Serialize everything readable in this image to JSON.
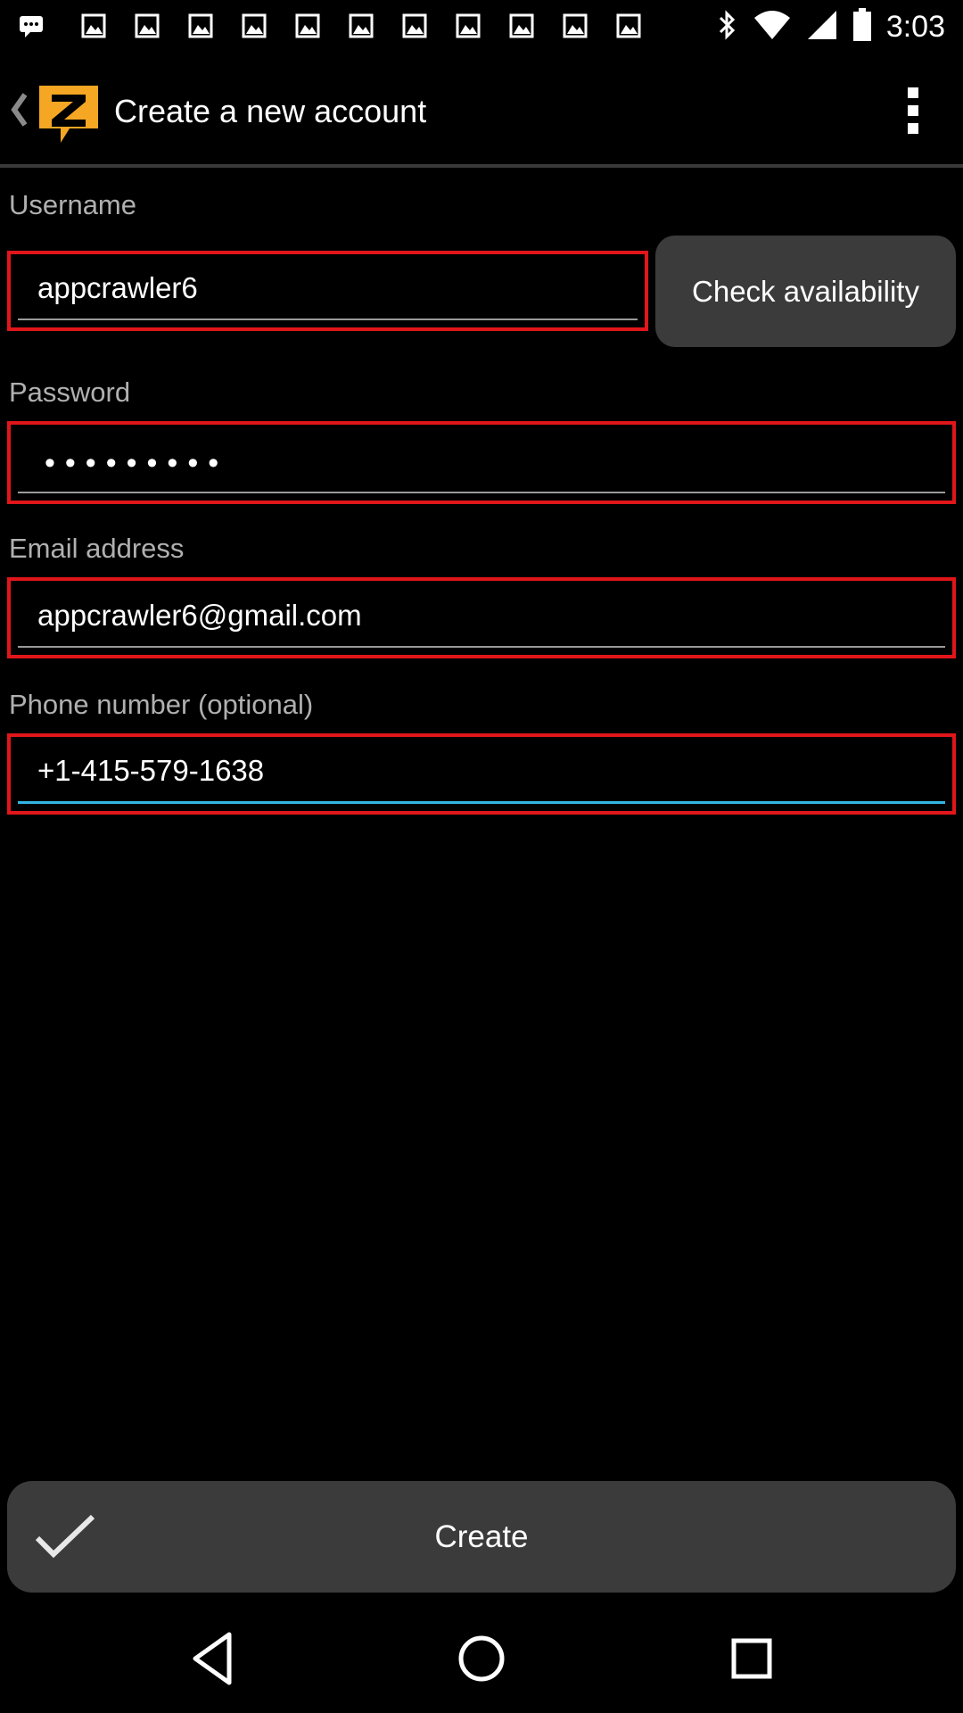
{
  "status_bar": {
    "time": "3:03",
    "notification_icons": [
      "message-icon",
      "photo-icon",
      "photo-icon",
      "photo-icon",
      "photo-icon",
      "photo-icon",
      "photo-icon",
      "photo-icon",
      "photo-icon",
      "photo-icon",
      "photo-icon",
      "photo-icon"
    ]
  },
  "action_bar": {
    "title": "Create a new account",
    "logo_letter": "Z"
  },
  "form": {
    "username": {
      "label": "Username",
      "value": "appcrawler6"
    },
    "check_availability_label": "Check availability",
    "password": {
      "label": "Password",
      "masked": "•••••••••"
    },
    "email": {
      "label": "Email address",
      "value": "appcrawler6@gmail.com"
    },
    "phone": {
      "label": "Phone number (optional)",
      "value": "+1-415-579-1638"
    }
  },
  "create_button": {
    "label": "Create"
  },
  "colors": {
    "field_highlight": "#e0161a",
    "focus_underline": "#33b5e5",
    "logo_orange": "#f5a623",
    "button_bg": "#3b3b3b"
  }
}
